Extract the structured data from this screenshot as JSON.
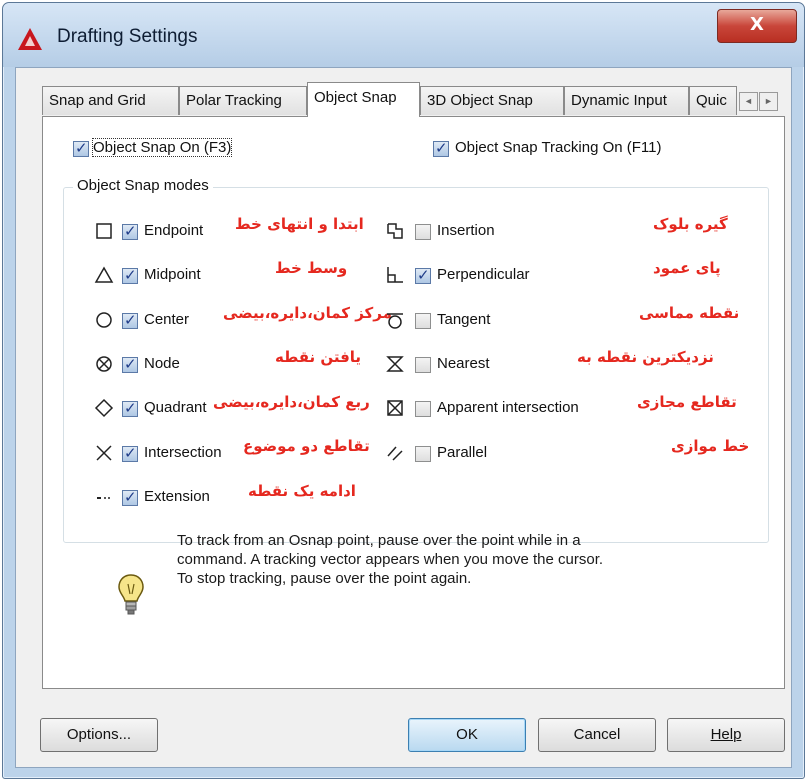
{
  "window": {
    "title": "Drafting Settings",
    "close_glyph": "X"
  },
  "tabs": [
    {
      "label": "Snap and Grid",
      "active": false
    },
    {
      "label": "Polar Tracking",
      "active": false
    },
    {
      "label": "Object Snap",
      "active": true
    },
    {
      "label": "3D Object Snap",
      "active": false
    },
    {
      "label": "Dynamic Input",
      "active": false
    },
    {
      "label": "Quic",
      "active": false
    }
  ],
  "tab_scroll": {
    "left": "◄",
    "right": "►"
  },
  "top_options": {
    "object_snap_on": {
      "label": "Object Snap On (F3)",
      "checked": true
    },
    "object_snap_tracking_on": {
      "label": "Object Snap Tracking On (F11)",
      "checked": true
    }
  },
  "group_title": "Object Snap modes",
  "modes_left": [
    {
      "label": "Endpoint",
      "checked": true,
      "icon": "square-icon",
      "annotation": "ابتدا و انتهای خط"
    },
    {
      "label": "Midpoint",
      "checked": true,
      "icon": "triangle-icon",
      "annotation": "وسط خط"
    },
    {
      "label": "Center",
      "checked": true,
      "icon": "circle-icon",
      "annotation": "مرکز کمان،دایره،بیضی"
    },
    {
      "label": "Node",
      "checked": true,
      "icon": "node-icon",
      "annotation": "یافتن نقطه"
    },
    {
      "label": "Quadrant",
      "checked": true,
      "icon": "diamond-icon",
      "annotation": "ربع کمان،دایره،بیضی"
    },
    {
      "label": "Intersection",
      "checked": true,
      "icon": "cross-icon",
      "annotation": "تقاطع دو موضوع"
    },
    {
      "label": "Extension",
      "checked": true,
      "icon": "extension-icon",
      "annotation": "ادامه یک نقطه"
    }
  ],
  "modes_right": [
    {
      "label": "Insertion",
      "checked": false,
      "icon": "insertion-icon",
      "annotation": "گیره بلوک"
    },
    {
      "label": "Perpendicular",
      "checked": true,
      "icon": "perpendicular-icon",
      "annotation": "پای عمود"
    },
    {
      "label": "Tangent",
      "checked": false,
      "icon": "tangent-icon",
      "annotation": "نقطه مماسی"
    },
    {
      "label": "Nearest",
      "checked": false,
      "icon": "nearest-icon",
      "annotation": "نزدیکترین نقطه به"
    },
    {
      "label": "Apparent intersection",
      "checked": false,
      "icon": "apparent-intersection-icon",
      "annotation": "تقاطع مجازی"
    },
    {
      "label": "Parallel",
      "checked": false,
      "icon": "parallel-icon",
      "annotation": "خط موازی"
    }
  ],
  "tip": {
    "icon": "lightbulb-icon",
    "line1": "To track from an Osnap point, pause over the point while in a",
    "line2": "command.  A tracking vector appears when you move the cursor.",
    "line3": "To stop tracking, pause over the point again."
  },
  "buttons": {
    "options": "Options...",
    "ok": "OK",
    "cancel": "Cancel",
    "help": "Help"
  },
  "colors": {
    "annotation": "#e5281f",
    "checkmark": "#213e8a",
    "title_bar": "#c8dbef",
    "close_button": "#c9463a"
  }
}
